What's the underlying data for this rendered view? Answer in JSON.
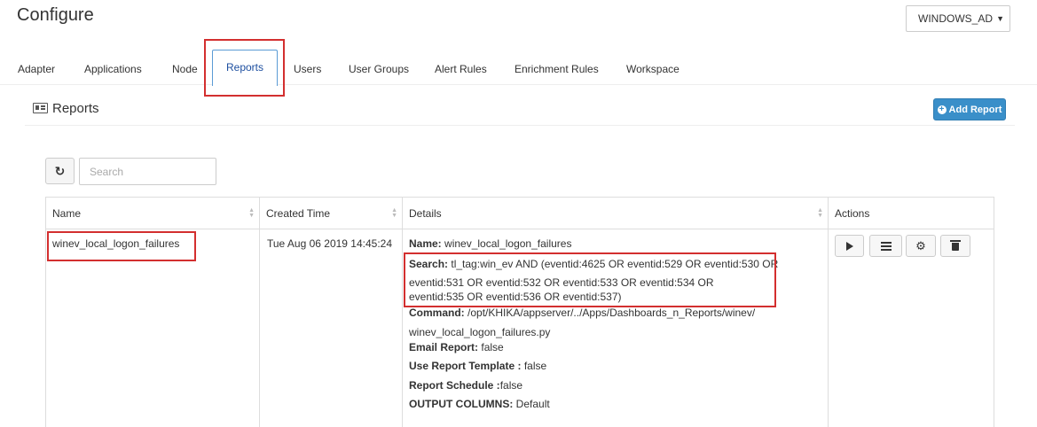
{
  "page": {
    "title": "Configure"
  },
  "env_select": {
    "value": "WINDOWS_AD"
  },
  "tabs": [
    {
      "label": "Adapter"
    },
    {
      "label": "Applications"
    },
    {
      "label": "Node"
    },
    {
      "label": "Reports"
    },
    {
      "label": "Users"
    },
    {
      "label": "User Groups"
    },
    {
      "label": "Alert Rules"
    },
    {
      "label": "Enrichment Rules"
    },
    {
      "label": "Workspace"
    }
  ],
  "section": {
    "title": "Reports",
    "add_label": "Add Report"
  },
  "search": {
    "placeholder": "Search"
  },
  "table": {
    "headers": {
      "name": "Name",
      "created": "Created Time",
      "details": "Details",
      "actions": "Actions"
    },
    "row": {
      "name": "winev_local_logon_failures",
      "created": "Tue Aug 06 2019 14:45:24",
      "details": {
        "name_label": "Name:",
        "name_value": "winev_local_logon_failures",
        "search_label": "Search:",
        "search_line1": "tl_tag:win_ev AND (eventid:4625 OR eventid:529 OR eventid:530 OR",
        "search_line2": "eventid:531 OR eventid:532 OR eventid:533 OR eventid:534 OR",
        "search_line3": "eventid:535 OR eventid:536 OR eventid:537)",
        "command_label": "Command:",
        "command_line1": "/opt/KHIKA/appserver/../Apps/Dashboards_n_Reports/winev/",
        "command_line2": "winev_local_logon_failures.py",
        "email_label": "Email Report:",
        "email_value": "false",
        "template_label": "Use Report Template :",
        "template_value": "false",
        "schedule_label": "Report Schedule :",
        "schedule_value": "false",
        "output_label": "OUTPUT COLUMNS:",
        "output_value": "Default"
      }
    }
  }
}
